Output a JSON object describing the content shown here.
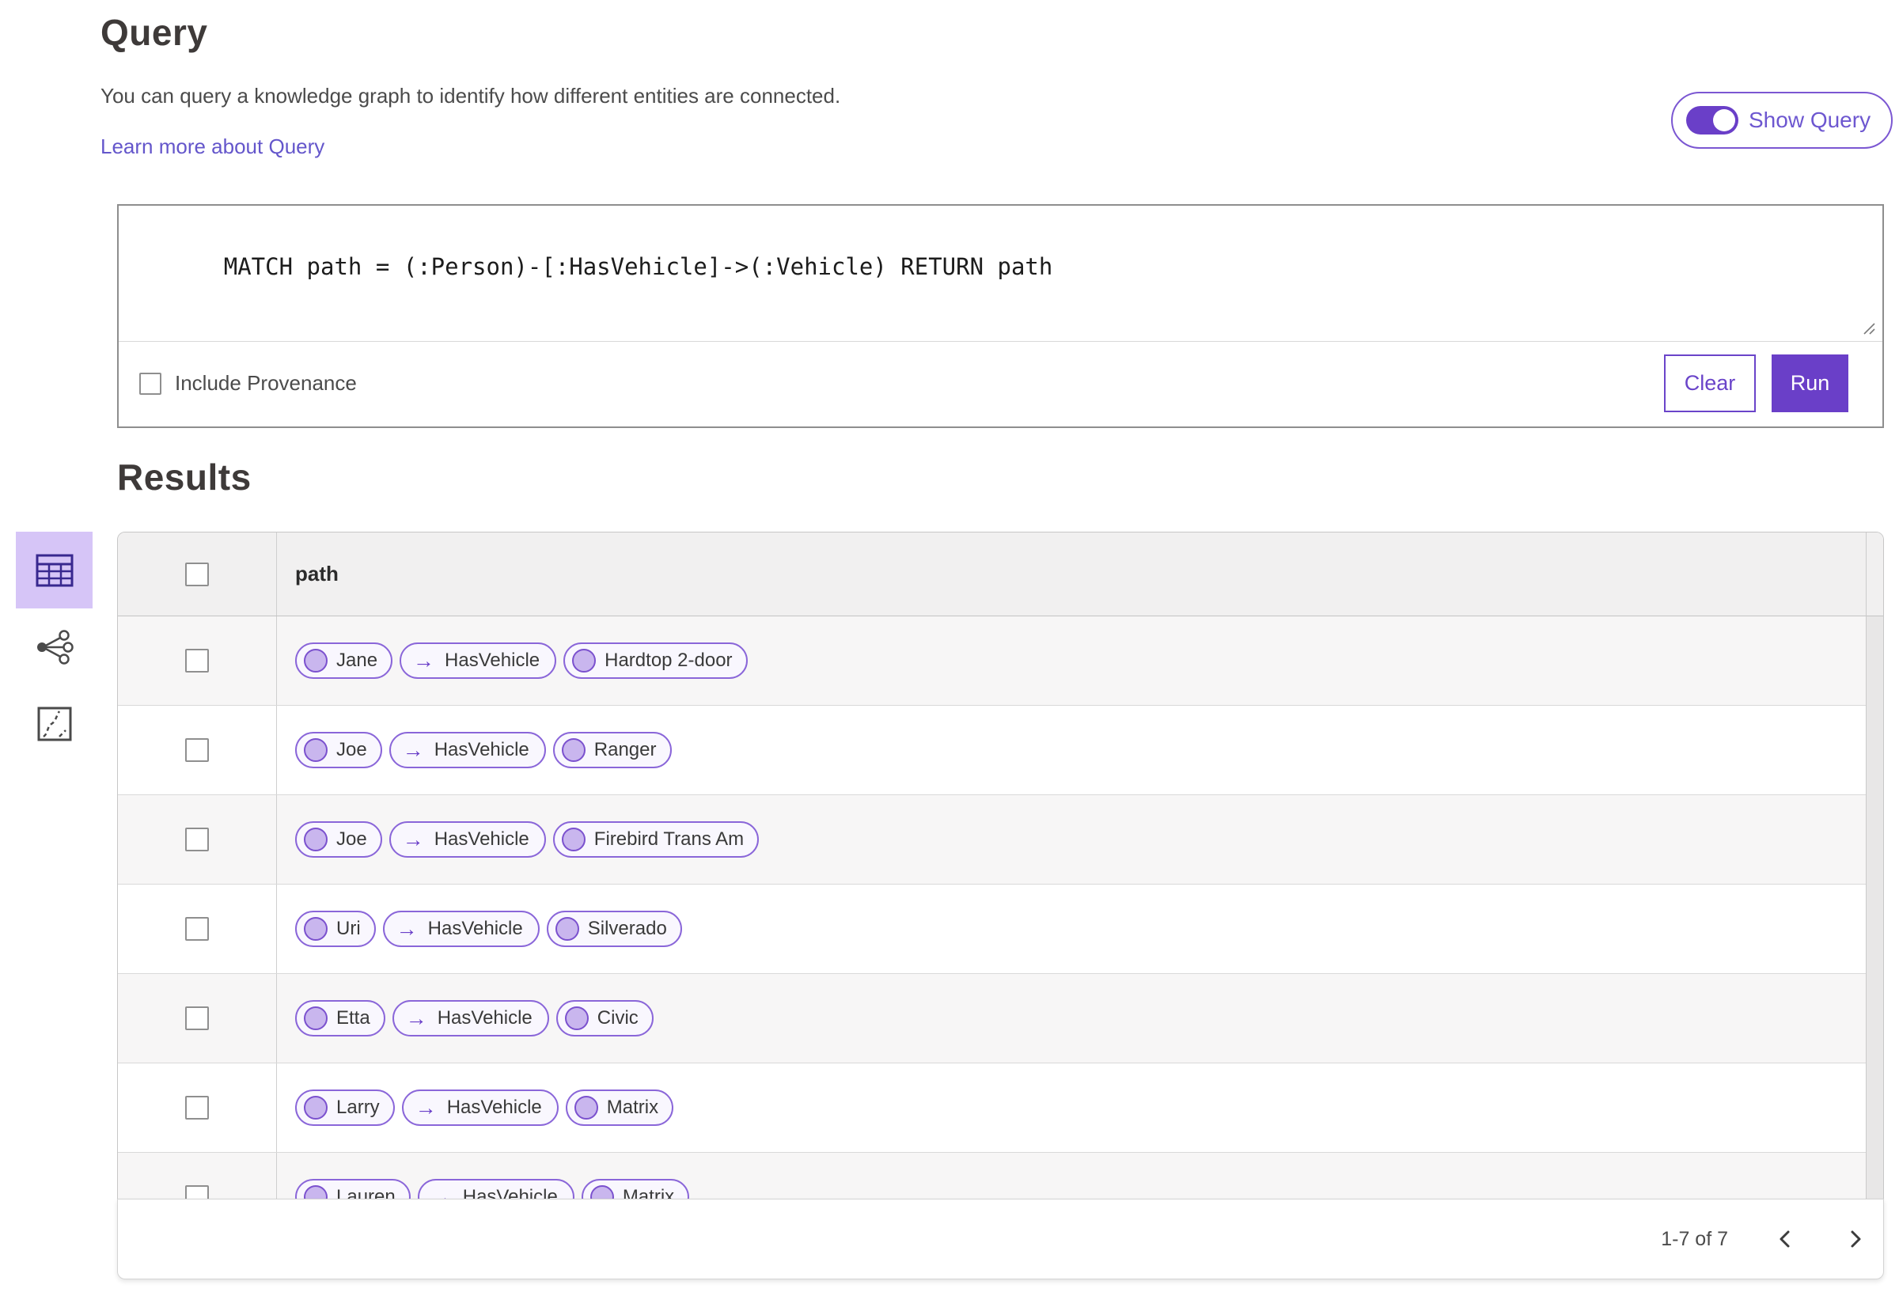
{
  "header": {
    "title": "Query",
    "description": "You can query a knowledge graph to identify how different entities are connected.",
    "learn_more_link": "Learn more about Query",
    "show_query_toggle": {
      "label": "Show Query",
      "state": "on"
    }
  },
  "query_panel": {
    "query_text": "MATCH path = (:Person)-[:HasVehicle]->(:Vehicle) RETURN path",
    "include_provenance_label": "Include Provenance",
    "include_provenance_checked": false,
    "clear_button": "Clear",
    "run_button": "Run"
  },
  "results": {
    "title": "Results",
    "view_switcher": [
      {
        "name": "table-view",
        "icon": "table-icon",
        "selected": true
      },
      {
        "name": "link-chart-view",
        "icon": "link-chart-icon",
        "selected": false
      },
      {
        "name": "map-view",
        "icon": "map-icon",
        "selected": false
      }
    ],
    "table": {
      "column_header": "path",
      "select_all_checked": false,
      "rows": [
        {
          "entity": "Jane",
          "relationship": "HasVehicle",
          "target": "Hardtop 2-door"
        },
        {
          "entity": "Joe",
          "relationship": "HasVehicle",
          "target": "Ranger"
        },
        {
          "entity": "Joe",
          "relationship": "HasVehicle",
          "target": "Firebird Trans Am"
        },
        {
          "entity": "Uri",
          "relationship": "HasVehicle",
          "target": "Silverado"
        },
        {
          "entity": "Etta",
          "relationship": "HasVehicle",
          "target": "Civic"
        },
        {
          "entity": "Larry",
          "relationship": "HasVehicle",
          "target": "Matrix"
        },
        {
          "entity": "Lauren",
          "relationship": "HasVehicle",
          "target": "Matrix"
        }
      ]
    },
    "pagination": {
      "range_label": "1-7 of 7",
      "prev_icon": "chevron-left",
      "next_icon": "chevron-right"
    }
  },
  "icons": {
    "arrow_right_glyph": "→"
  },
  "colors": {
    "accent_purple": "#6a3fc8",
    "toggle_border": "#7b57d2",
    "link": "#6456cb",
    "pill_border": "#8a66d9",
    "pill_background": "#f9f7fe",
    "node_circle_fill": "#c9b6ee",
    "node_circle_border": "#7b51ce",
    "selected_view_background": "#d6c5f7",
    "table_header_background": "#f1f0f0",
    "alt_row_background": "#f7f6f6"
  }
}
